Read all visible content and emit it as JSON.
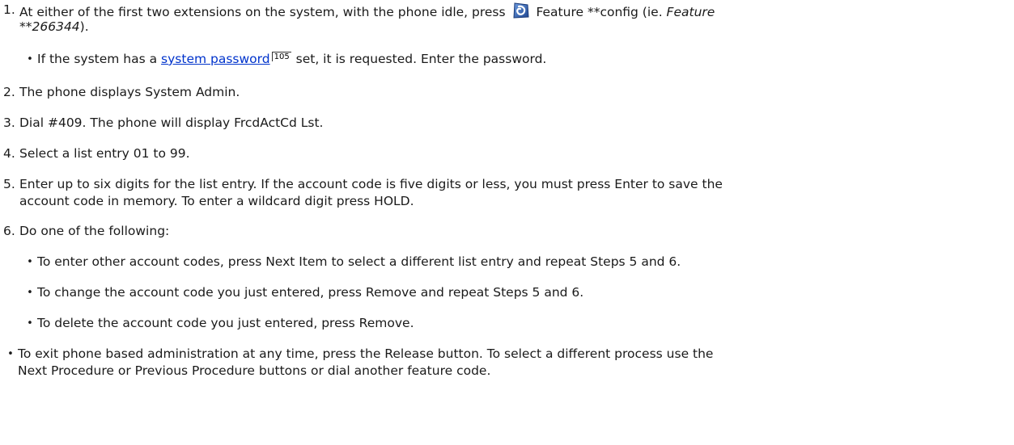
{
  "steps": [
    {
      "num": "1.",
      "before_icon": "At either of the first two extensions on the system, with the phone idle, press ",
      "icon": "feature-button-icon",
      "after_icon": " Feature **config (ie. ",
      "italic_line1": "Feature",
      "italic_line2": "**266344",
      "tail": ")."
    },
    {
      "num": "2.",
      "text": "The phone displays System Admin."
    },
    {
      "num": "3.",
      "text": "Dial #409. The phone will display FrcdActCd Lst."
    },
    {
      "num": "4.",
      "text": "Select a list entry 01 to 99."
    },
    {
      "num": "5.",
      "line1": "Enter up to six digits for the list entry. If the account code is five digits or less, you must press Enter to save the",
      "line2": "account code in memory. To enter a wildcard digit press HOLD."
    },
    {
      "num": "6.",
      "text": "Do one of the following:"
    }
  ],
  "step1_bullet": {
    "before_link": "If the system has a ",
    "link": "system password",
    "xref": "105",
    "after_link": " set, it is requested. Enter the password."
  },
  "step6_bullets": [
    "To enter other account codes, press Next Item to select a different list entry and repeat Steps 5 and 6.",
    "To change the account code you just entered, press Remove and repeat Steps 5 and 6.",
    "To delete the account code you just entered, press Remove."
  ],
  "final_bullet": {
    "line1": "To exit phone based administration at any time, press the Release button. To select a different process use the",
    "line2": "Next Procedure or Previous Procedure buttons or dial another feature code."
  },
  "bullet_glyph": "•",
  "colors": {
    "link": "#0033cc",
    "icon_blue": "#2f5fa8"
  }
}
